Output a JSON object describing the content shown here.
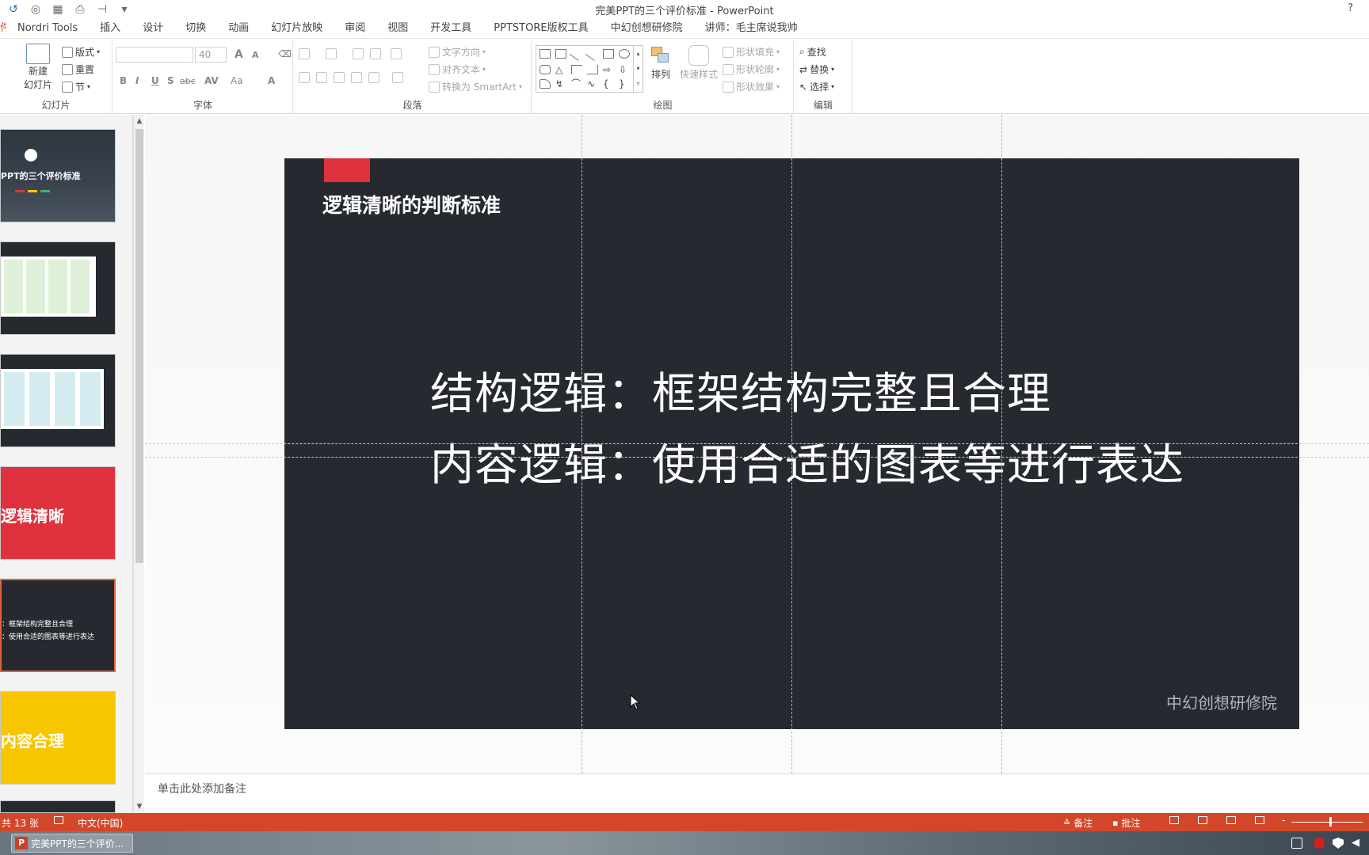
{
  "window": {
    "title": "完美PPT的三个评价标准 - PowerPoint",
    "help": "?"
  },
  "tabs": [
    "Nordri Tools",
    "插入",
    "设计",
    "切换",
    "动画",
    "幻灯片放映",
    "审阅",
    "视图",
    "开发工具",
    "PPTSTORE版权工具",
    "中幻创想研修院",
    "讲师：毛主席说我帅"
  ],
  "ribbon": {
    "slides": {
      "label": "幻灯片",
      "new_slide": "新建",
      "new_slide_2": "幻灯片",
      "layout": "版式",
      "reset": "重置",
      "section": "节"
    },
    "font": {
      "label": "字体",
      "font_name": "",
      "font_size": "40",
      "bold": "B",
      "italic": "I",
      "underline": "U",
      "shadow": "S",
      "strike": "abc",
      "spacing": "AV",
      "case": "Aa",
      "color": "A",
      "grow": "A",
      "shrink": "A"
    },
    "paragraph": {
      "label": "段落",
      "text_direction": "文字方向",
      "align_text": "对齐文本",
      "convert_smartart": "转换为 SmartArt"
    },
    "drawing": {
      "label": "绘图",
      "arrange": "排列",
      "quick_styles": "快速样式",
      "shape_fill": "形状填充",
      "shape_outline": "形状轮廓",
      "shape_effects": "形状效果"
    },
    "editing": {
      "label": "编辑",
      "find": "查找",
      "replace": "替换",
      "select": "选择"
    }
  },
  "thumbnails": [
    {
      "text": "PPT的三个评价标准",
      "bg": "#2e3640"
    },
    {
      "text": "",
      "bg": "#ffffff"
    },
    {
      "text": "",
      "bg": "#ffffff"
    },
    {
      "text": "逻辑清晰",
      "bg": "#e0313e"
    },
    {
      "line1": "：框架结构完整且合理",
      "line2": "：使用合适的图表等进行表达",
      "bg": "#262a30"
    },
    {
      "text": "内容合理",
      "bg": "#f7c600"
    }
  ],
  "slide": {
    "title": "逻辑清晰的判断标准",
    "line1": "结构逻辑：框架结构完整且合理",
    "line2": "内容逻辑：使用合适的图表等进行表达",
    "footer": "中幻创想研修院",
    "accent_color": "#e0313e",
    "background_color": "#262a30"
  },
  "notes": {
    "placeholder": "单击此处添加备注"
  },
  "status": {
    "slide_count": "共 13 张",
    "language": "中文(中国)",
    "notes": "备注",
    "comments": "批注",
    "color": "#d2472a"
  },
  "taskbar": {
    "item": "完美PPT的三个评价..."
  }
}
